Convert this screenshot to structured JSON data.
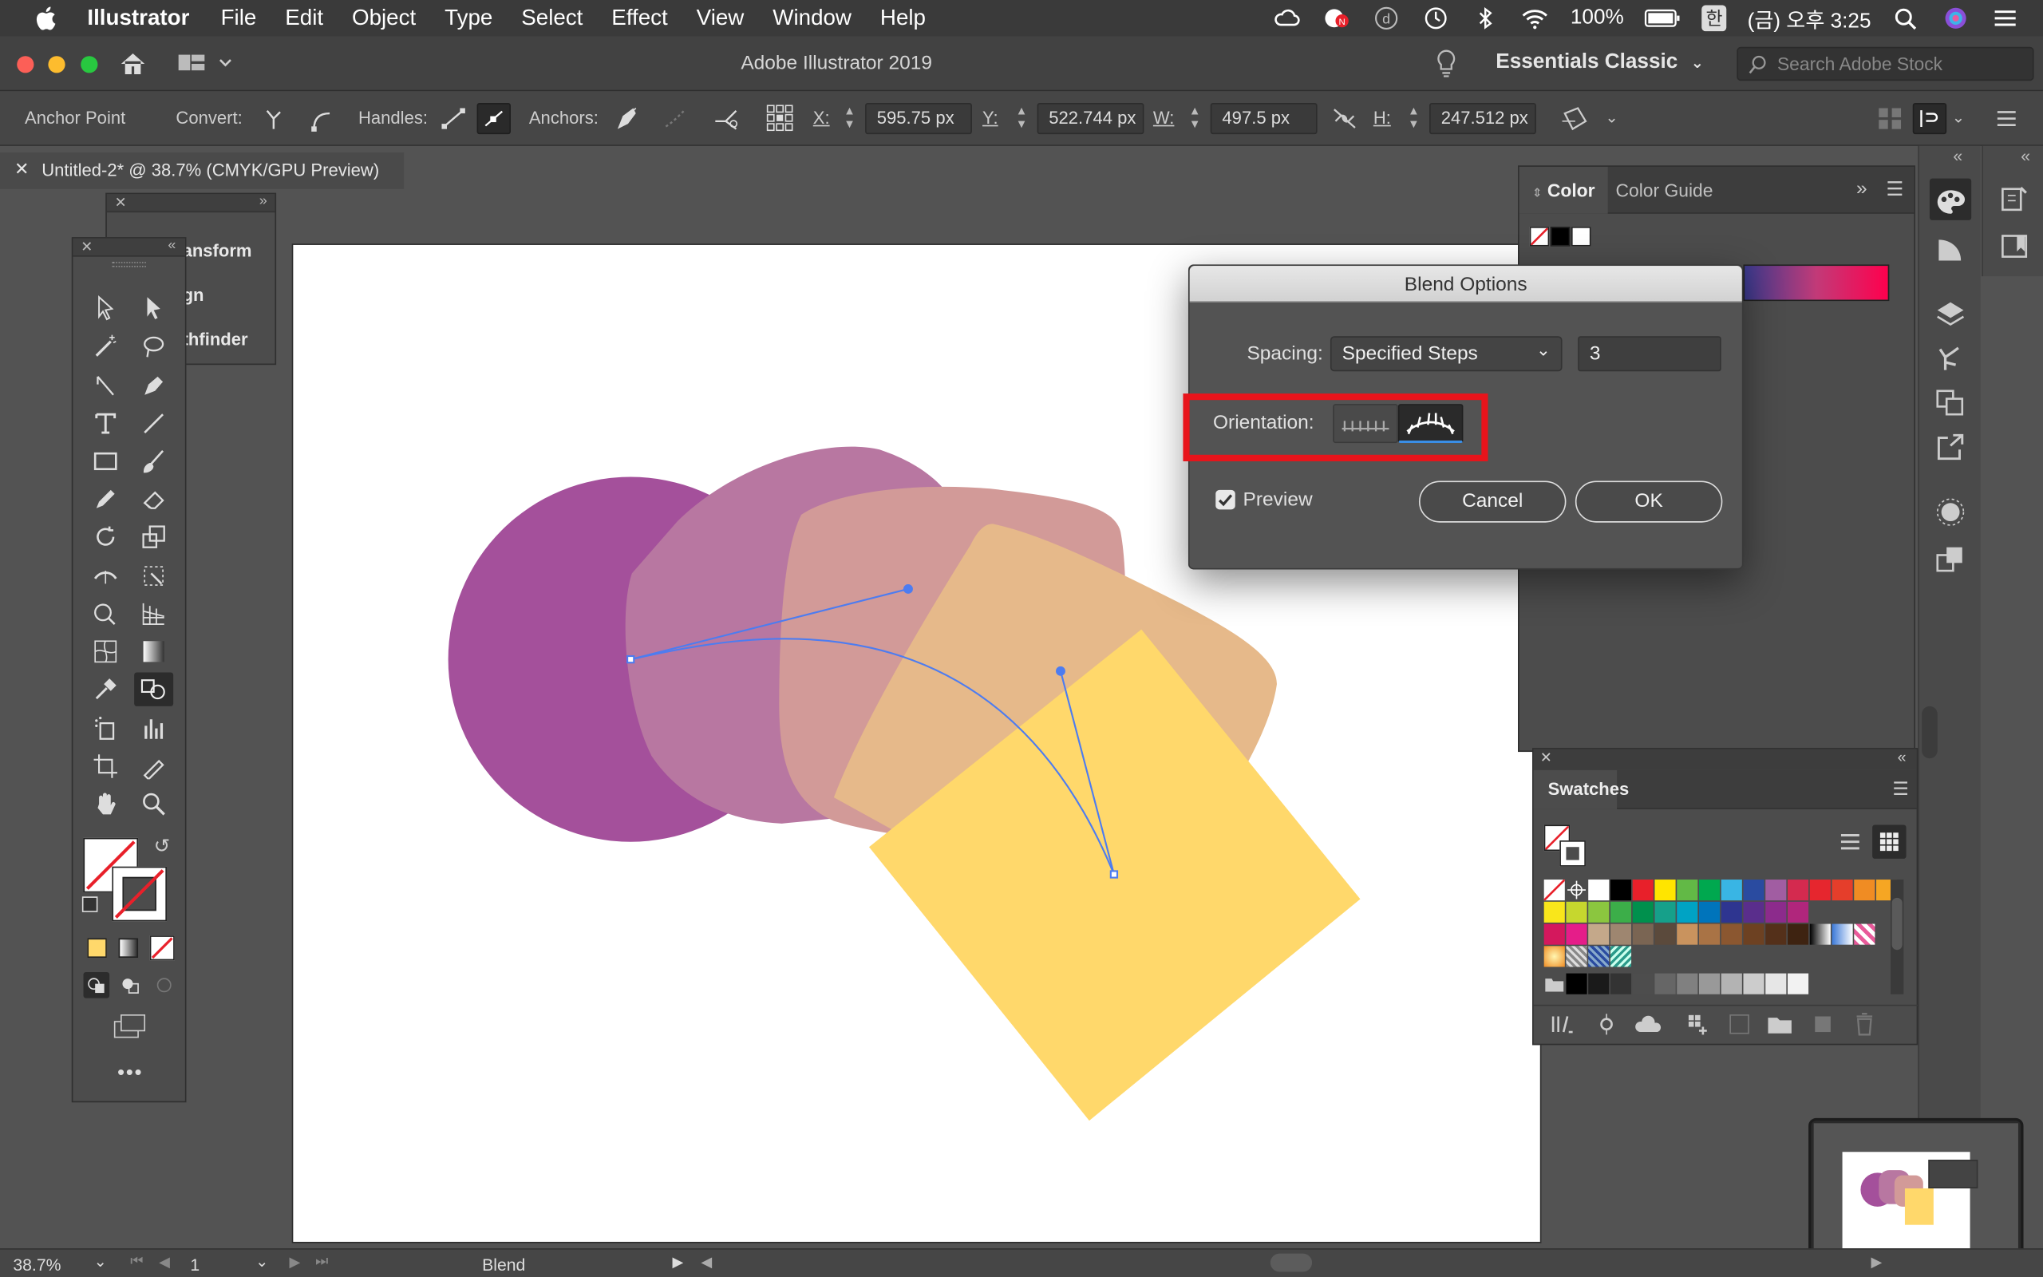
{
  "menubar": {
    "app": "Illustrator",
    "items": [
      "File",
      "Edit",
      "Object",
      "Type",
      "Select",
      "Effect",
      "View",
      "Window",
      "Help"
    ],
    "battery": "100%",
    "input_method": "한",
    "clock": "(금) 오후 3:25"
  },
  "appbar": {
    "title": "Adobe Illustrator 2019",
    "workspace": "Essentials Classic",
    "stock_placeholder": "Search Adobe Stock"
  },
  "control": {
    "mode": "Anchor Point",
    "convert_label": "Convert:",
    "handles_label": "Handles:",
    "anchors_label": "Anchors:",
    "x_label": "X:",
    "x_value": "595.75 px",
    "y_label": "Y:",
    "y_value": "522.744 px",
    "w_label": "W:",
    "w_value": "497.5 px",
    "h_label": "H:",
    "h_value": "247.512 px"
  },
  "document": {
    "tab_title": "Untitled-2* @ 38.7% (CMYK/GPU Preview)"
  },
  "mini_panel": {
    "items": [
      "ansform",
      "gn",
      "thfinder"
    ]
  },
  "color_panel": {
    "tabs": [
      "Color",
      "Color Guide"
    ]
  },
  "swatches_panel": {
    "title": "Swatches",
    "colors": {
      "row1": [
        "#ffffff",
        "#000000",
        "#e8202a",
        "#ffe500",
        "#62b946",
        "#00a84f",
        "#39b5e4",
        "#2a4ba0",
        "#a15da2",
        "#d42a4f",
        "#e6262e",
        "#e53e2b",
        "#f08c23",
        "#f6a623"
      ],
      "row2": [
        "#f9e61b",
        "#c6d72e",
        "#8bc63f",
        "#3cae49",
        "#00904d",
        "#16a08a",
        "#00a3c4",
        "#0074bb",
        "#2e3590",
        "#5a2e8c",
        "#8c2b8c",
        "#b0267c"
      ],
      "row3": [
        "#d4185d",
        "#e51d89",
        "#c4a88a",
        "#9e8670",
        "#7a6553",
        "#5b4a3c",
        "#c9935e",
        "#a97345",
        "#8b5730",
        "#6d4122",
        "#54301a",
        "#3e2311"
      ],
      "grays": [
        "#000000",
        "#1a1a1a",
        "#333333",
        "#4d4d4d",
        "#666666",
        "#808080",
        "#999999",
        "#b3b3b3",
        "#cccccc",
        "#e6e6e6",
        "#f2f2f2"
      ]
    }
  },
  "dialog": {
    "title": "Blend Options",
    "spacing_label": "Spacing:",
    "spacing_value": "Specified Steps",
    "steps_value": "3",
    "orientation_label": "Orientation:",
    "preview_label": "Preview",
    "preview_checked": true,
    "cancel_label": "Cancel",
    "ok_label": "OK"
  },
  "artwork": {
    "colors": [
      "#a4509b",
      "#b877a1",
      "#d29a98",
      "#e6b98a",
      "#ffd86b"
    ],
    "path_color": "#4d7cf0"
  },
  "status": {
    "zoom": "38.7%",
    "artboard": "1",
    "tool": "Blend"
  }
}
